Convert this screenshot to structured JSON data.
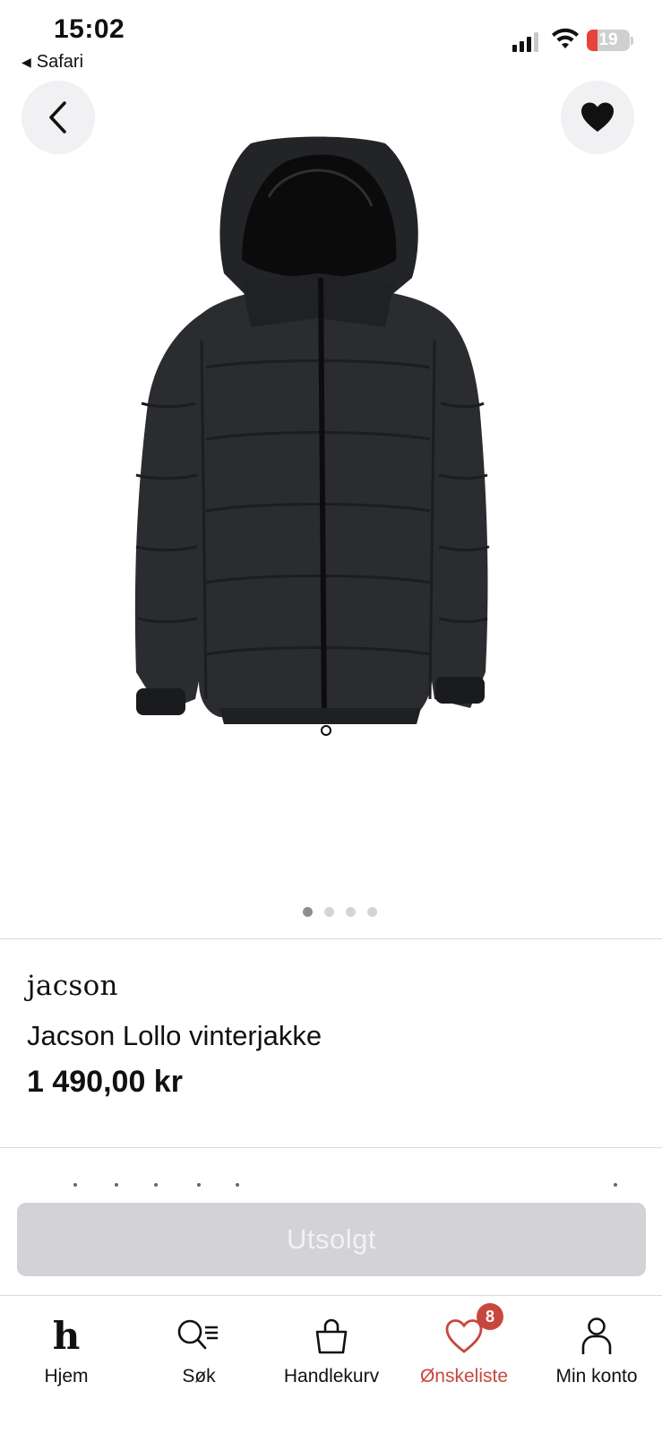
{
  "status_bar": {
    "time": "15:02",
    "back_label": "Safari",
    "battery": "19"
  },
  "product": {
    "brand": "jacson",
    "name": "Jacson Lollo vinterjakke",
    "price": "1 490,00 kr",
    "image_count": 4,
    "active_image": 1
  },
  "cta": {
    "label": "Utsolgt"
  },
  "tab_bar": {
    "items": [
      {
        "label": "Hjem",
        "icon": "home-h-icon"
      },
      {
        "label": "Søk",
        "icon": "search-list-icon"
      },
      {
        "label": "Handlekurv",
        "icon": "shopping-bag-icon"
      },
      {
        "label": "Ønskeliste",
        "icon": "heart-icon",
        "badge": "8",
        "active": true
      },
      {
        "label": "Min konto",
        "icon": "person-icon"
      }
    ]
  },
  "colors": {
    "accent": "#c8473d",
    "button_disabled": "#d2d2d7"
  }
}
